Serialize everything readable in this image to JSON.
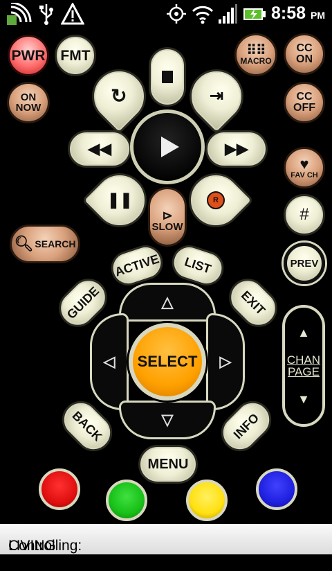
{
  "status_bar": {
    "time": "8:58",
    "ampm": "PM",
    "icons": [
      "wifi-notification-icon",
      "usb-icon",
      "warning-icon",
      "gps-icon",
      "wifi-icon",
      "signal-icon",
      "battery-icon"
    ]
  },
  "buttons": {
    "pwr": "PWR",
    "fmt": "FMT",
    "macro": "MACRO",
    "cc_on": [
      "CC",
      "ON"
    ],
    "on_now": [
      "ON",
      "NOW"
    ],
    "cc_off": [
      "CC",
      "OFF"
    ],
    "fav_ch": "FAV CH",
    "hash": "#",
    "search": "SEARCH",
    "slow": "SLOW",
    "prev": "PREV",
    "active": "ACTIVE",
    "list": "LIST",
    "guide": "GUIDE",
    "exit": "EXIT",
    "select": "SELECT",
    "chan": "CHAN",
    "page": "PAGE",
    "back": "BACK",
    "info": "INFO",
    "menu": "MENU",
    "record": "R"
  },
  "colors": {
    "red": "#e01010",
    "green": "#18c018",
    "yellow": "#ffe010",
    "blue": "#2020e0",
    "select": "#ffa000"
  },
  "footer": {
    "label": "Controlling:",
    "room": "LIVING ROOM"
  }
}
